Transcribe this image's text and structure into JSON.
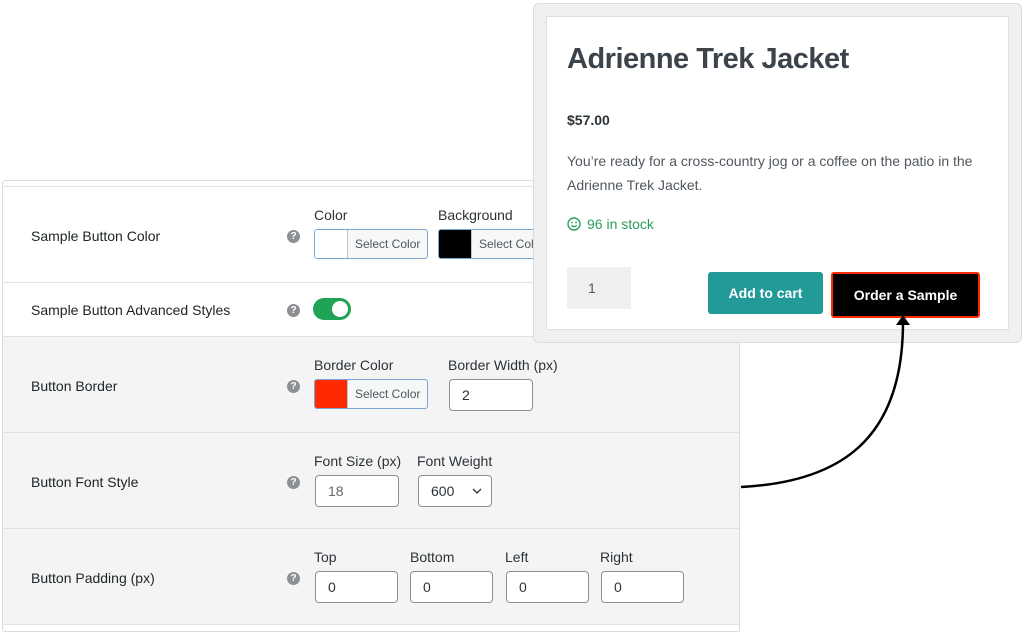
{
  "settings": {
    "rows": [
      {
        "label": "Sample Button Color",
        "fields": [
          {
            "label": "Color",
            "button": "Select Color",
            "swatch": "#ffffff"
          },
          {
            "label": "Background",
            "button": "Select Color",
            "swatch": "#000000"
          }
        ]
      },
      {
        "label": "Sample Button Advanced Styles",
        "toggle_on": true
      },
      {
        "label": "Button Border",
        "fields": [
          {
            "label": "Border Color",
            "button": "Select Color",
            "swatch": "#ff2a00"
          },
          {
            "label": "Border Width (px)",
            "value": "2"
          }
        ]
      },
      {
        "label": "Button Font Style",
        "fields": [
          {
            "label": "Font Size (px)",
            "value": "18"
          },
          {
            "label": "Font Weight",
            "value": "600"
          }
        ]
      },
      {
        "label": "Button Padding (px)",
        "fields": [
          {
            "label": "Top",
            "value": "0"
          },
          {
            "label": "Bottom",
            "value": "0"
          },
          {
            "label": "Left",
            "value": "0"
          },
          {
            "label": "Right",
            "value": "0"
          }
        ]
      }
    ],
    "help_glyph": "?"
  },
  "product": {
    "title": "Adrienne Trek Jacket",
    "price": "$57.00",
    "description": "You’re ready for a cross-country jog or a coffee on the patio in the Adrienne Trek Jacket.",
    "stock": "96 in stock",
    "quantity": "1",
    "add_to_cart": "Add to cart",
    "order_sample": "Order a Sample"
  },
  "colors": {
    "toggle": "#1fa355",
    "add_to_cart": "#229a97",
    "sample_border": "#ff2a00",
    "stock": "#2a9d5c"
  }
}
